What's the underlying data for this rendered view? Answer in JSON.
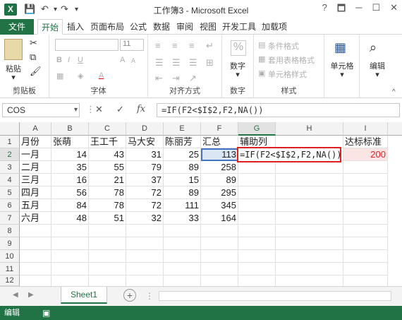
{
  "window": {
    "title": "工作簿3 - Microsoft Excel",
    "logo": "X",
    "icons": [
      "excel-logo-icon",
      "save-icon",
      "undo-icon",
      "redo-icon",
      "customize-icon"
    ],
    "controls": [
      "?",
      "🗖",
      "─",
      "☐",
      "✕"
    ]
  },
  "tabs": [
    "文件",
    "开始",
    "插入",
    "页面布局",
    "公式",
    "数据",
    "审阅",
    "视图",
    "开发工具",
    "加载项"
  ],
  "ribbon": {
    "paste_label": "粘贴",
    "clipboard_label": "剪贴板",
    "font_label": "字体",
    "font_size": "11",
    "bold": "B",
    "italic": "I",
    "underline": "U",
    "font_grow": "A",
    "font_shrink": "A",
    "font_color": "A",
    "align_label": "对齐方式",
    "number_label": "数字",
    "percent": "%",
    "styles_label": "样式",
    "cond_format": "条件格式",
    "table_format": "套用表格格式",
    "cell_styles": "单元格样式",
    "cells_label": "单元格",
    "edit_label": "编辑"
  },
  "formula_bar": {
    "name_box": "COS",
    "cancel": "✕",
    "enter": "✓",
    "fx": "fx",
    "formula": "=IF(F2<$I$2,F2,NA())"
  },
  "columns": [
    "A",
    "B",
    "C",
    "D",
    "E",
    "F",
    "G",
    "H",
    "I"
  ],
  "rows": [
    "1",
    "2",
    "3",
    "4",
    "5",
    "6",
    "7",
    "8",
    "9",
    "10",
    "11",
    "12"
  ],
  "sheet": {
    "headers": [
      "月份",
      "张萌",
      "王工千",
      "马大安",
      "陈丽芳",
      "汇总",
      "辅助列",
      "",
      "达标标准"
    ],
    "data": [
      [
        "一月",
        "14",
        "43",
        "31",
        "25",
        "113",
        "",
        "",
        "200"
      ],
      [
        "二月",
        "35",
        "55",
        "79",
        "89",
        "258",
        "",
        "",
        ""
      ],
      [
        "三月",
        "16",
        "21",
        "37",
        "15",
        "89",
        "",
        "",
        ""
      ],
      [
        "四月",
        "56",
        "78",
        "72",
        "89",
        "295",
        "",
        "",
        ""
      ],
      [
        "五月",
        "84",
        "78",
        "72",
        "111",
        "345",
        "",
        "",
        ""
      ],
      [
        "六月",
        "48",
        "51",
        "32",
        "33",
        "164",
        "",
        "",
        ""
      ]
    ],
    "editing_formula": "=IF(F2<$I$2,F2,NA())"
  },
  "sheet_tabs": {
    "active": "Sheet1",
    "add": "+"
  },
  "status": {
    "mode": "编辑"
  },
  "colors": {
    "accent": "#217346",
    "selection_border": "#e02020"
  }
}
